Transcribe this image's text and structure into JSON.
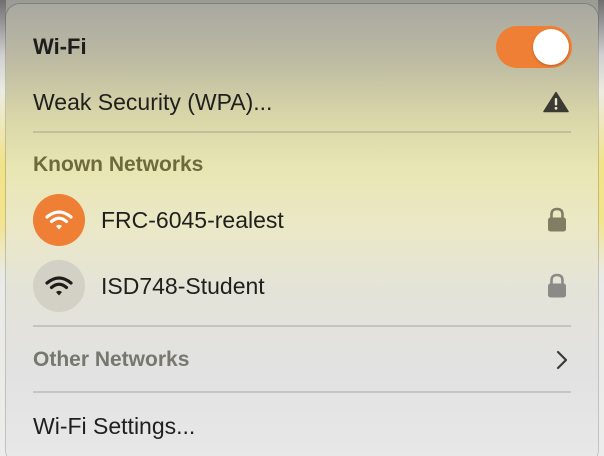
{
  "header": {
    "title": "Wi-Fi",
    "toggle_on": true
  },
  "current_network": {
    "label": "Weak Security (WPA)...",
    "icon": "warning-triangle-icon"
  },
  "known_networks": {
    "heading": "Known Networks",
    "items": [
      {
        "name": "FRC-6045-realest",
        "connected": true,
        "locked": true,
        "icon": "wifi-icon"
      },
      {
        "name": "ISD748-Student",
        "connected": false,
        "locked": true,
        "icon": "wifi-icon"
      }
    ]
  },
  "other_networks": {
    "label": "Other Networks",
    "icon": "chevron-right-icon"
  },
  "settings": {
    "label": "Wi-Fi Settings..."
  },
  "colors": {
    "accent": "#ee7f34",
    "section_heading": "#6e6a3e",
    "other_networks_text": "#77776f"
  }
}
